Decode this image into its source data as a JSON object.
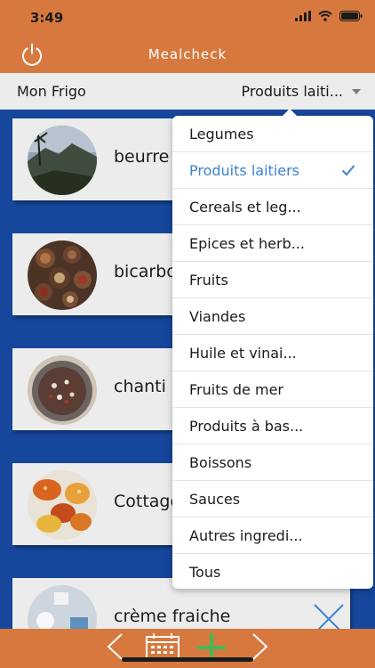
{
  "status_bar": {
    "time": "3:49"
  },
  "header": {
    "title": "Mealcheck"
  },
  "subbar": {
    "left_label": "Mon Frigo",
    "category_selected": "Produits laiti..."
  },
  "items": [
    {
      "name": "beurre"
    },
    {
      "name": "bicarbo"
    },
    {
      "name": "chanti"
    },
    {
      "name": "Cottage"
    },
    {
      "name": "crème fraiche"
    }
  ],
  "dropdown": {
    "options": [
      "Legumes",
      "Produits laitiers",
      "Cereals et leg...",
      "Epices et herb...",
      "Fruits",
      "Viandes",
      "Huile et vinai...",
      "Fruits de mer",
      "Produits à bas...",
      "Boissons",
      "Sauces",
      "Autres ingredi...",
      "Tous"
    ],
    "selected": "Produits laitiers"
  },
  "colors": {
    "accent_orange": "#d7793f",
    "content_blue": "#16479d",
    "selected_blue": "#3b82d6",
    "add_green": "#44b854"
  }
}
